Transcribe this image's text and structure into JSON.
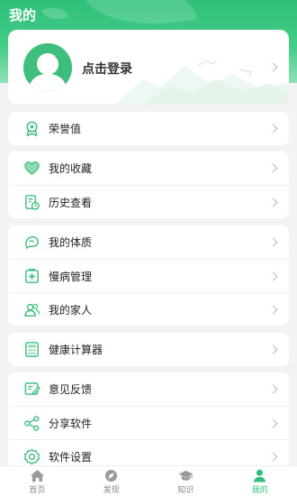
{
  "header": {
    "title": "我的"
  },
  "profile": {
    "login_text": "点击登录"
  },
  "groups": [
    {
      "items": [
        {
          "label": "荣誉值",
          "icon": "medal-icon"
        }
      ]
    },
    {
      "items": [
        {
          "label": "我的收藏",
          "icon": "heart-icon"
        },
        {
          "label": "历史查看",
          "icon": "history-icon"
        }
      ]
    },
    {
      "items": [
        {
          "label": "我的体质",
          "icon": "body-constitution-icon"
        },
        {
          "label": "慢病管理",
          "icon": "medical-kit-icon"
        },
        {
          "label": "我的家人",
          "icon": "family-icon"
        }
      ]
    },
    {
      "items": [
        {
          "label": "健康计算器",
          "icon": "calculator-icon"
        }
      ]
    },
    {
      "items": [
        {
          "label": "意见反馈",
          "icon": "feedback-icon"
        },
        {
          "label": "分享软件",
          "icon": "share-icon"
        },
        {
          "label": "软件设置",
          "icon": "gear-icon"
        }
      ]
    }
  ],
  "tabbar": {
    "tabs": [
      {
        "label": "首页",
        "icon": "home-icon"
      },
      {
        "label": "发现",
        "icon": "discover-icon"
      },
      {
        "label": "知识",
        "icon": "graduation-cap-icon"
      },
      {
        "label": "我的",
        "icon": "user-icon"
      }
    ],
    "active_index": 3
  },
  "colors": {
    "accent": "#2fbf78",
    "background": "#f2f3f5",
    "icon_stroke": "#3fbf7f"
  }
}
